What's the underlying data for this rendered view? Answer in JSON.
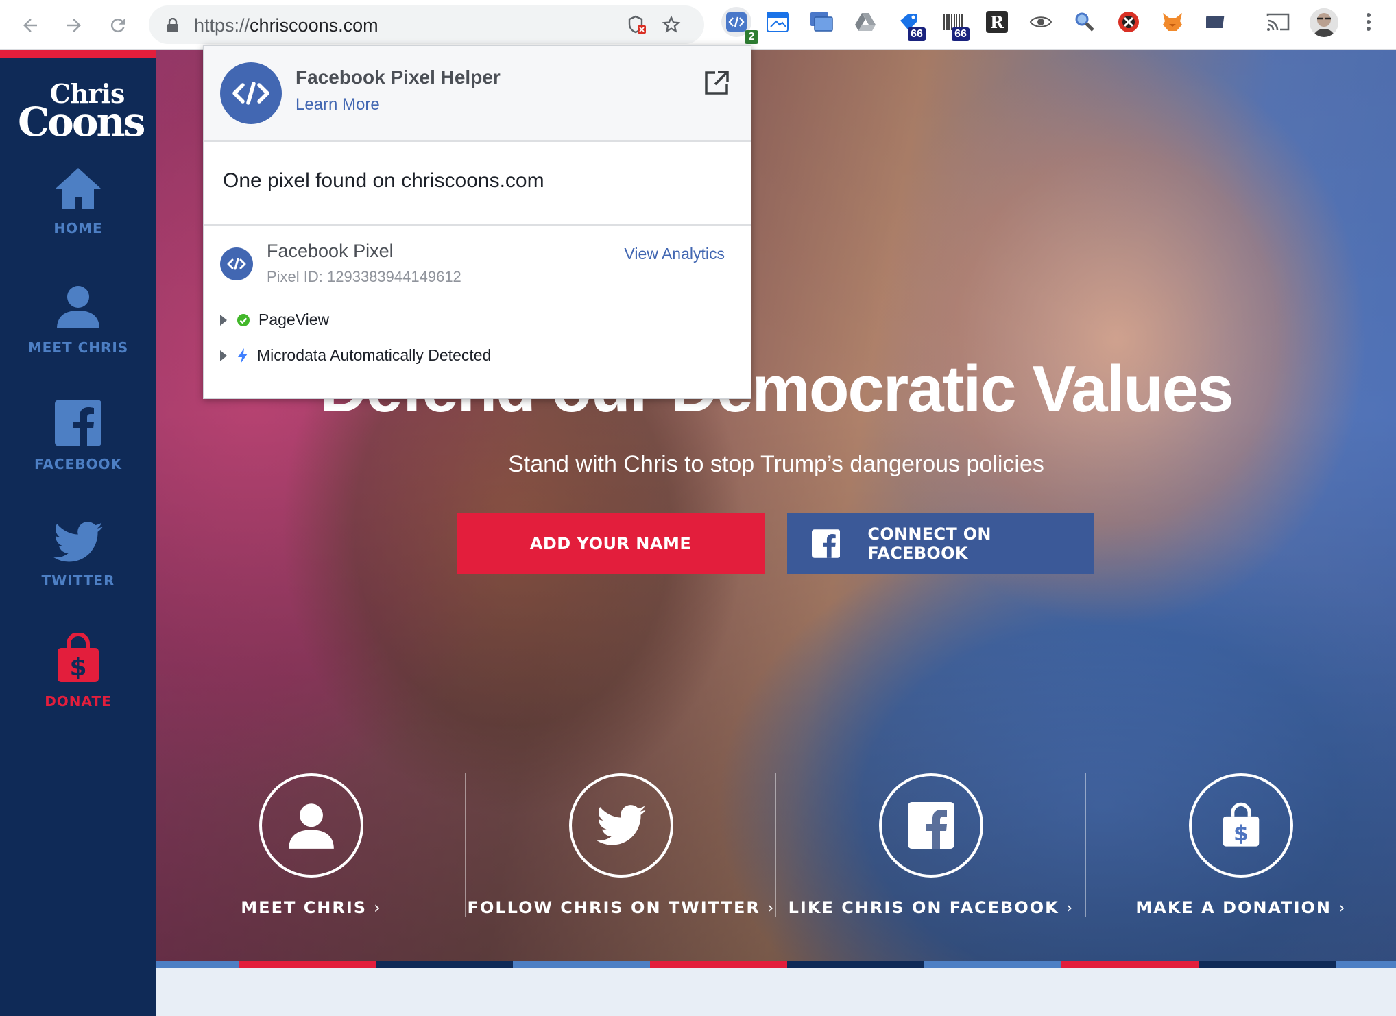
{
  "browser": {
    "url_protocol": "https://",
    "url_host": "chriscoons.com",
    "extension_badges": {
      "pixel_helper": "2",
      "ext_a": "66",
      "ext_b": "66"
    }
  },
  "sidebar": {
    "logo_line1": "Chris",
    "logo_line2": "Coons",
    "items": [
      {
        "label": "HOME",
        "icon": "home-icon"
      },
      {
        "label": "MEET CHRIS",
        "icon": "person-icon"
      },
      {
        "label": "FACEBOOK",
        "icon": "facebook-icon"
      },
      {
        "label": "TWITTER",
        "icon": "twitter-icon"
      },
      {
        "label": "DONATE",
        "icon": "donate-bag-icon"
      }
    ]
  },
  "hero": {
    "headline": "Defend our Democratic Values",
    "subline": "Stand with Chris to stop Trump’s dangerous policies",
    "add_name_label": "ADD YOUR NAME",
    "connect_fb_label": "CONNECT ON FACEBOOK"
  },
  "ctas": [
    {
      "label": "MEET CHRIS",
      "chevron": "›",
      "icon": "person-icon"
    },
    {
      "label": "FOLLOW CHRIS ON TWITTER",
      "chevron": "›",
      "icon": "twitter-icon"
    },
    {
      "label": "LIKE CHRIS ON FACEBOOK",
      "chevron": "›",
      "icon": "facebook-icon"
    },
    {
      "label": "MAKE A DONATION",
      "chevron": "›",
      "icon": "donate-bag-icon"
    }
  ],
  "popup": {
    "title": "Facebook Pixel Helper",
    "learn_more": "Learn More",
    "summary": "One pixel found on chriscoons.com",
    "pixel_name": "Facebook Pixel",
    "pixel_id": "Pixel ID: 1293383944149612",
    "view_analytics": "View Analytics",
    "events": [
      {
        "name": "PageView",
        "status": "success"
      },
      {
        "name": "Microdata Automatically Detected",
        "status": "automatic"
      }
    ]
  },
  "colors": {
    "brand_navy": "#0f2a57",
    "brand_red": "#e31e3c",
    "facebook_blue": "#3b5998",
    "nav_blue": "#4d7fc4"
  }
}
